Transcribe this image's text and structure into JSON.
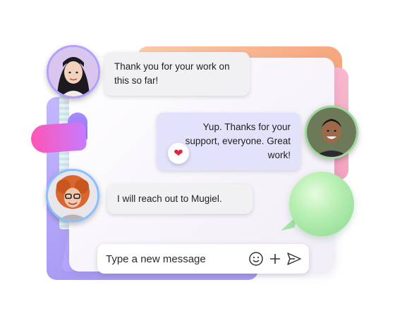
{
  "messages": [
    {
      "text": "Thank you for your work on this so far!",
      "side": "in"
    },
    {
      "text": "Yup. Thanks for your support, everyone. Great work!",
      "side": "out",
      "reaction": "heart-icon"
    },
    {
      "text": "I will reach out to Mugiel.",
      "side": "in"
    }
  ],
  "composer": {
    "placeholder": "Type a new message",
    "icons": [
      "emoji-icon",
      "add-icon",
      "send-icon"
    ]
  },
  "colors": {
    "accent": "#b69cff",
    "bubble_out": "#e3e2fb",
    "bubble_in": "#f1f1f3",
    "heart": "#e0243c"
  }
}
